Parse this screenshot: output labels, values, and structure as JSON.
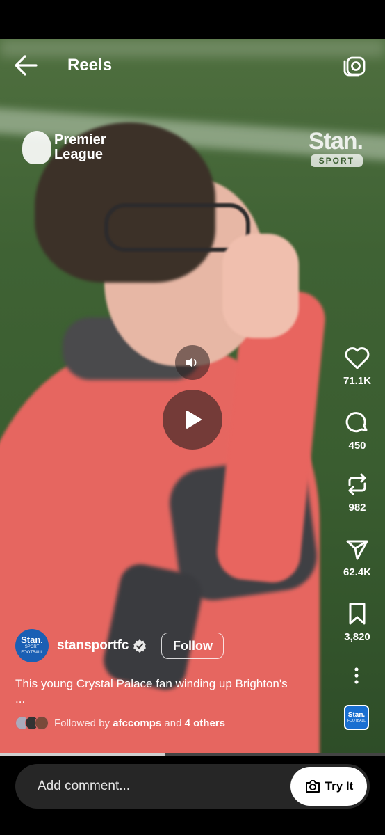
{
  "header": {
    "title": "Reels",
    "back_icon": "arrow-left-icon",
    "camera_icon": "camera-icon"
  },
  "video": {
    "overlay_logos": {
      "left": "Premier League",
      "left_line1": "Premier",
      "left_line2": "League",
      "right_word": "Stan.",
      "right_badge": "SPORT"
    },
    "state": "paused"
  },
  "actions": [
    {
      "name": "like",
      "icon": "heart-icon",
      "count": "71.1K"
    },
    {
      "name": "comment",
      "icon": "comment-icon",
      "count": "450"
    },
    {
      "name": "repost",
      "icon": "repost-icon",
      "count": "982"
    },
    {
      "name": "share",
      "icon": "send-icon",
      "count": "62.4K"
    },
    {
      "name": "save",
      "icon": "bookmark-icon",
      "count": "3,820"
    }
  ],
  "author": {
    "avatar_line1": "Stan.",
    "avatar_line2": "SPORT",
    "avatar_line3": "FOOTBALL",
    "username": "stansportfc",
    "verified": true,
    "follow_label": "Follow"
  },
  "caption": "This young Crystal Palace fan winding up Brighton's",
  "caption_more": "...",
  "followed_by": {
    "prefix": "Followed by",
    "first": "afccomps",
    "joiner": "and",
    "others": "4 others"
  },
  "audio_thumb": {
    "line1": "Stan.",
    "line2": "FOOTBALL"
  },
  "progress": 0.43,
  "comment": {
    "placeholder": "Add comment...",
    "try_it_label": "Try It"
  },
  "colors": {
    "background": "#000000",
    "follow_border": "#ffffff",
    "avatar_blue": "#1a5fb4"
  }
}
